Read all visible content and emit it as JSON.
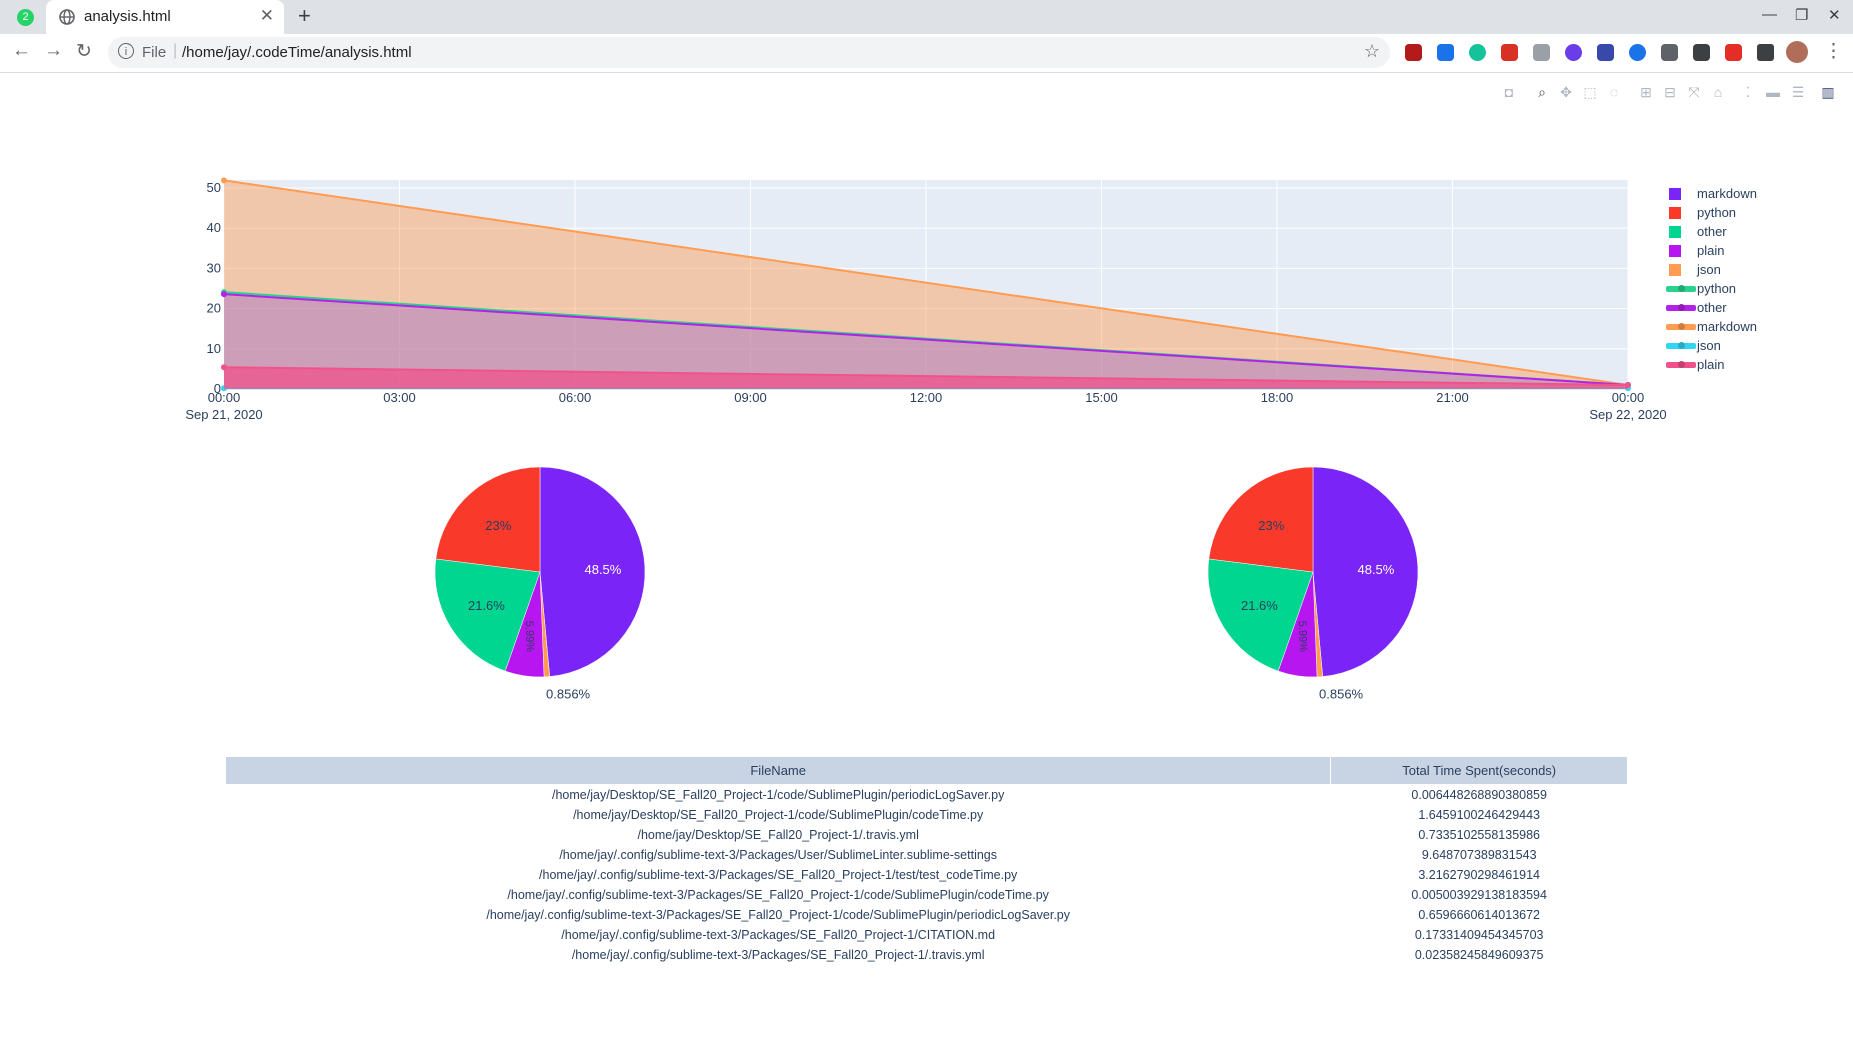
{
  "browser": {
    "tab_title": "analysis.html",
    "new_tab": "+",
    "app_badge": "2",
    "scheme": "File",
    "url": "/home/jay/.codeTime/analysis.html"
  },
  "colors": {
    "markdown": "#7b24f7",
    "python": "#f93a2a",
    "other": "#00d68f",
    "plain": "#b716f0",
    "json": "#ff9c52",
    "line_python": "#2ad28e",
    "line_other": "#b621e8",
    "line_markdown": "#ff9c52",
    "line_json": "#33d6f2",
    "line_plain": "#f0528b",
    "plot_bg": "#e5ecf6"
  },
  "legend": {
    "pie_entries": [
      "markdown",
      "python",
      "other",
      "plain",
      "json"
    ],
    "line_entries": [
      "python",
      "other",
      "markdown",
      "json",
      "plain"
    ]
  },
  "chart_data": [
    {
      "type": "area",
      "x_ticks": [
        "00:00",
        "03:00",
        "06:00",
        "09:00",
        "12:00",
        "15:00",
        "18:00",
        "21:00",
        "00:00"
      ],
      "x_dates": [
        "Sep 21, 2020",
        "Sep 22, 2020"
      ],
      "x": [
        "2020-09-21 00:00",
        "2020-09-22 00:00"
      ],
      "y_ticks": [
        "0",
        "10",
        "20",
        "30",
        "40",
        "50"
      ],
      "ylim": [
        0,
        52
      ],
      "series": [
        {
          "name": "python",
          "values": [
            24.1,
            1.0
          ]
        },
        {
          "name": "other",
          "values": [
            23.6,
            1.0
          ]
        },
        {
          "name": "markdown",
          "values": [
            51.9,
            1.0
          ]
        },
        {
          "name": "json",
          "values": [
            0.2,
            0.2
          ]
        },
        {
          "name": "plain",
          "values": [
            5.4,
            1.0
          ]
        }
      ]
    },
    {
      "type": "pie",
      "labels": [
        "markdown",
        "json",
        "plain",
        "other",
        "python"
      ],
      "values": [
        48.5,
        0.856,
        5.99,
        21.6,
        23
      ],
      "text": [
        "48.5%",
        "0.856%",
        "5.99%",
        "21.6%",
        "23%"
      ]
    },
    {
      "type": "pie",
      "labels": [
        "markdown",
        "json",
        "plain",
        "other",
        "python"
      ],
      "values": [
        48.5,
        0.856,
        5.99,
        21.6,
        23
      ],
      "text": [
        "48.5%",
        "0.856%",
        "5.99%",
        "21.6%",
        "23%"
      ]
    },
    {
      "type": "table",
      "columns": [
        "FileName",
        "Total Time Spent(seconds)"
      ],
      "rows": [
        [
          "/home/jay/Desktop/SE_Fall20_Project-1/code/SublimePlugin/periodicLogSaver.py",
          "0.006448268890380859"
        ],
        [
          "/home/jay/Desktop/SE_Fall20_Project-1/code/SublimePlugin/codeTime.py",
          "1.6459100246429443"
        ],
        [
          "/home/jay/Desktop/SE_Fall20_Project-1/.travis.yml",
          "0.7335102558135986"
        ],
        [
          "/home/jay/.config/sublime-text-3/Packages/User/SublimeLinter.sublime-settings",
          "9.648707389831543"
        ],
        [
          "/home/jay/.config/sublime-text-3/Packages/SE_Fall20_Project-1/test/test_codeTime.py",
          "3.2162790298461914"
        ],
        [
          "/home/jay/.config/sublime-text-3/Packages/SE_Fall20_Project-1/code/SublimePlugin/codeTime.py",
          "0.005003929138183594"
        ],
        [
          "/home/jay/.config/sublime-text-3/Packages/SE_Fall20_Project-1/code/SublimePlugin/periodicLogSaver.py",
          "0.6596660614013672"
        ],
        [
          "/home/jay/.config/sublime-text-3/Packages/SE_Fall20_Project-1/CITATION.md",
          "0.17331409454345703"
        ],
        [
          "/home/jay/.config/sublime-text-3/Packages/SE_Fall20_Project-1/.travis.yml",
          "0.02358245849609375"
        ]
      ]
    }
  ]
}
